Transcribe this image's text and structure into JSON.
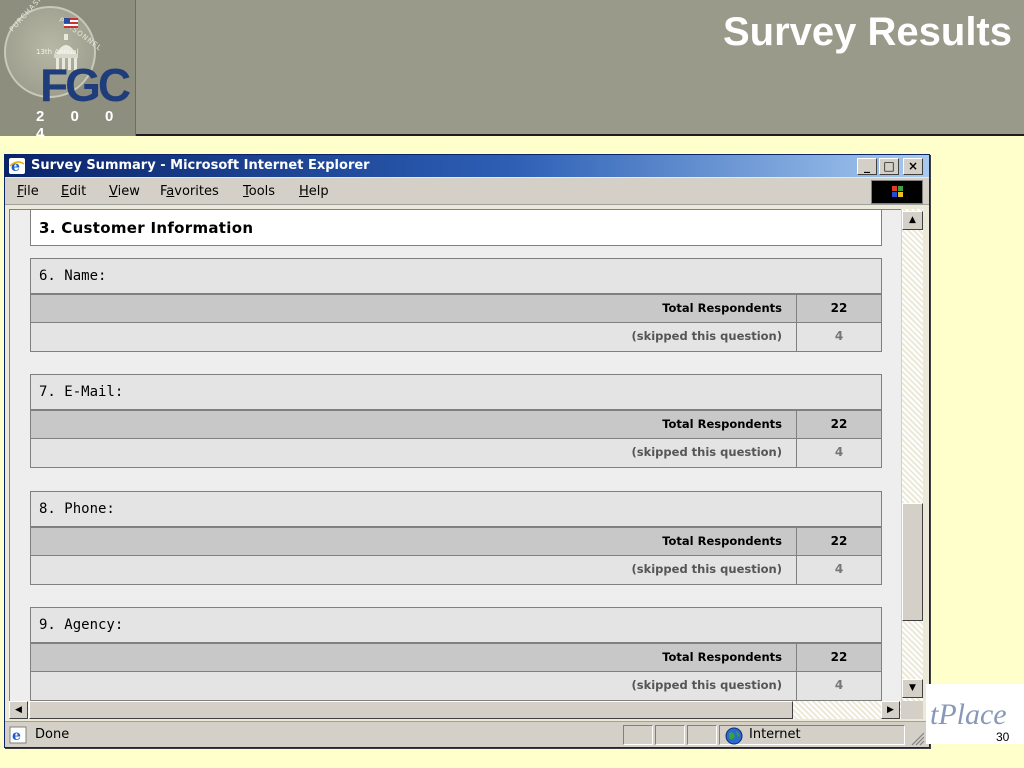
{
  "slide": {
    "title": "Survey Results",
    "page_number": "30",
    "logo": {
      "text": "FGC",
      "year": "2 0 0 4",
      "arc_top": "TECHNOLOGY",
      "arc_right": "PERSONNEL",
      "arc_left": "PURCHASING",
      "annual": "13th Annual"
    },
    "brand_fragment": "tPlace"
  },
  "window": {
    "title": "Survey Summary - Microsoft Internet Explorer",
    "buttons": {
      "minimize": "_",
      "maximize": "□",
      "close": "×"
    }
  },
  "menu": {
    "file": {
      "u": "F",
      "rest": "ile"
    },
    "edit": {
      "u": "E",
      "rest": "dit"
    },
    "view": {
      "u": "V",
      "rest": "iew"
    },
    "favorites": {
      "pre": "F",
      "u": "a",
      "rest": "vorites"
    },
    "tools": {
      "u": "T",
      "rest": "ools"
    },
    "help": {
      "u": "H",
      "rest": "elp"
    }
  },
  "content": {
    "section_title": "3. Customer Information",
    "total_label": "Total Respondents",
    "skipped_label": "(skipped this question)",
    "questions": [
      {
        "label": "6. Name:",
        "total": "22",
        "skipped": "4"
      },
      {
        "label": "7. E-Mail:",
        "total": "22",
        "skipped": "4"
      },
      {
        "label": "8. Phone:",
        "total": "22",
        "skipped": "4"
      },
      {
        "label": "9. Agency:",
        "total": "22",
        "skipped": "4"
      }
    ]
  },
  "status": {
    "text": "Done",
    "zone": "Internet"
  },
  "colors": {
    "slide_bg": "#ffffcc",
    "header_bg": "#9a9a8a",
    "titlebar_start": "#0a246a",
    "titlebar_end": "#a6caf0",
    "fgc_blue": "#1e3d7a"
  }
}
